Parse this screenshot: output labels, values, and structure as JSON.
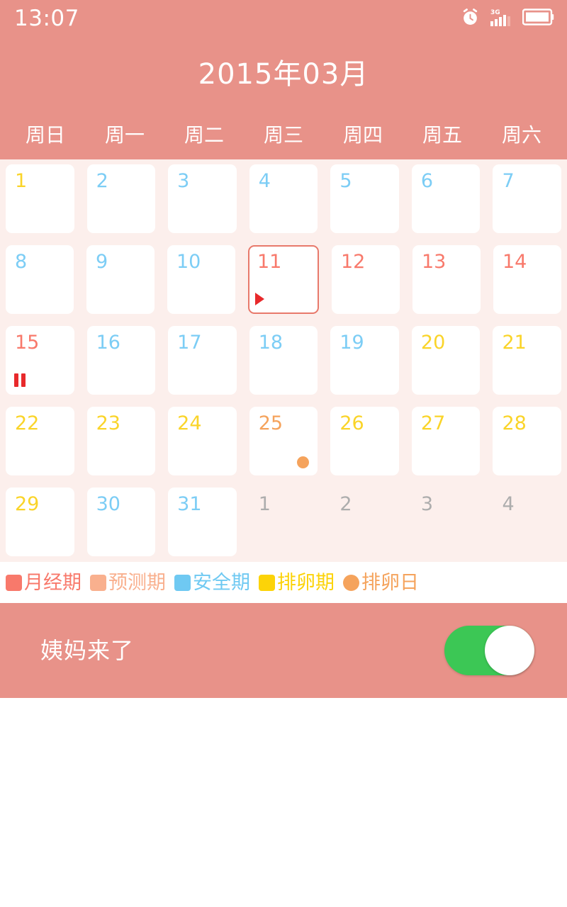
{
  "statusbar": {
    "time": "13:07",
    "icons": [
      "alarm-icon",
      "signal-3g-icon",
      "battery-icon"
    ],
    "network": "3G"
  },
  "header": {
    "title": "2015年03月",
    "background_color": "#E89289",
    "weekdays": [
      "周日",
      "周一",
      "周二",
      "周三",
      "周四",
      "周五",
      "周六"
    ]
  },
  "calendar": {
    "background_color": "#FCEFEC",
    "selected_day": 11,
    "weeks": [
      [
        {
          "num": "1",
          "type": "ovul",
          "current": true,
          "marker": ""
        },
        {
          "num": "2",
          "type": "safe",
          "current": true,
          "marker": ""
        },
        {
          "num": "3",
          "type": "safe",
          "current": true,
          "marker": ""
        },
        {
          "num": "4",
          "type": "safe",
          "current": true,
          "marker": ""
        },
        {
          "num": "5",
          "type": "safe",
          "current": true,
          "marker": ""
        },
        {
          "num": "6",
          "type": "safe",
          "current": true,
          "marker": ""
        },
        {
          "num": "7",
          "type": "safe",
          "current": true,
          "marker": ""
        }
      ],
      [
        {
          "num": "8",
          "type": "safe",
          "current": true,
          "marker": ""
        },
        {
          "num": "9",
          "type": "safe",
          "current": true,
          "marker": ""
        },
        {
          "num": "10",
          "type": "safe",
          "current": true,
          "marker": ""
        },
        {
          "num": "11",
          "type": "period",
          "current": true,
          "marker": "triangle",
          "selected": true
        },
        {
          "num": "12",
          "type": "period",
          "current": true,
          "marker": ""
        },
        {
          "num": "13",
          "type": "period",
          "current": true,
          "marker": ""
        },
        {
          "num": "14",
          "type": "period",
          "current": true,
          "marker": ""
        }
      ],
      [
        {
          "num": "15",
          "type": "period",
          "current": true,
          "marker": "pause"
        },
        {
          "num": "16",
          "type": "safe",
          "current": true,
          "marker": ""
        },
        {
          "num": "17",
          "type": "safe",
          "current": true,
          "marker": ""
        },
        {
          "num": "18",
          "type": "safe",
          "current": true,
          "marker": ""
        },
        {
          "num": "19",
          "type": "safe",
          "current": true,
          "marker": ""
        },
        {
          "num": "20",
          "type": "ovul",
          "current": true,
          "marker": ""
        },
        {
          "num": "21",
          "type": "ovul",
          "current": true,
          "marker": ""
        }
      ],
      [
        {
          "num": "22",
          "type": "ovul",
          "current": true,
          "marker": ""
        },
        {
          "num": "23",
          "type": "ovul",
          "current": true,
          "marker": ""
        },
        {
          "num": "24",
          "type": "ovul",
          "current": true,
          "marker": ""
        },
        {
          "num": "25",
          "type": "ovulday",
          "current": true,
          "marker": "dot"
        },
        {
          "num": "26",
          "type": "ovul",
          "current": true,
          "marker": ""
        },
        {
          "num": "27",
          "type": "ovul",
          "current": true,
          "marker": ""
        },
        {
          "num": "28",
          "type": "ovul",
          "current": true,
          "marker": ""
        }
      ],
      [
        {
          "num": "29",
          "type": "ovul",
          "current": true,
          "marker": ""
        },
        {
          "num": "30",
          "type": "safe",
          "current": true,
          "marker": ""
        },
        {
          "num": "31",
          "type": "safe",
          "current": true,
          "marker": ""
        },
        {
          "num": "1",
          "type": "other",
          "current": false,
          "marker": ""
        },
        {
          "num": "2",
          "type": "other",
          "current": false,
          "marker": ""
        },
        {
          "num": "3",
          "type": "other",
          "current": false,
          "marker": ""
        },
        {
          "num": "4",
          "type": "other",
          "current": false,
          "marker": ""
        }
      ]
    ]
  },
  "legend": {
    "items": [
      {
        "label": "月经期",
        "color": "#F8796B",
        "shape": "square"
      },
      {
        "label": "预测期",
        "color": "#F9B08E",
        "shape": "square"
      },
      {
        "label": "安全期",
        "color": "#6FC9F2",
        "shape": "square"
      },
      {
        "label": "排卵期",
        "color": "#FCD308",
        "shape": "square"
      },
      {
        "label": "排卵日",
        "color": "#F5A35C",
        "shape": "circle"
      }
    ]
  },
  "toggle_panel": {
    "label": "姨妈来了",
    "switch_state": "on",
    "switch_on_color": "#3CC755"
  }
}
